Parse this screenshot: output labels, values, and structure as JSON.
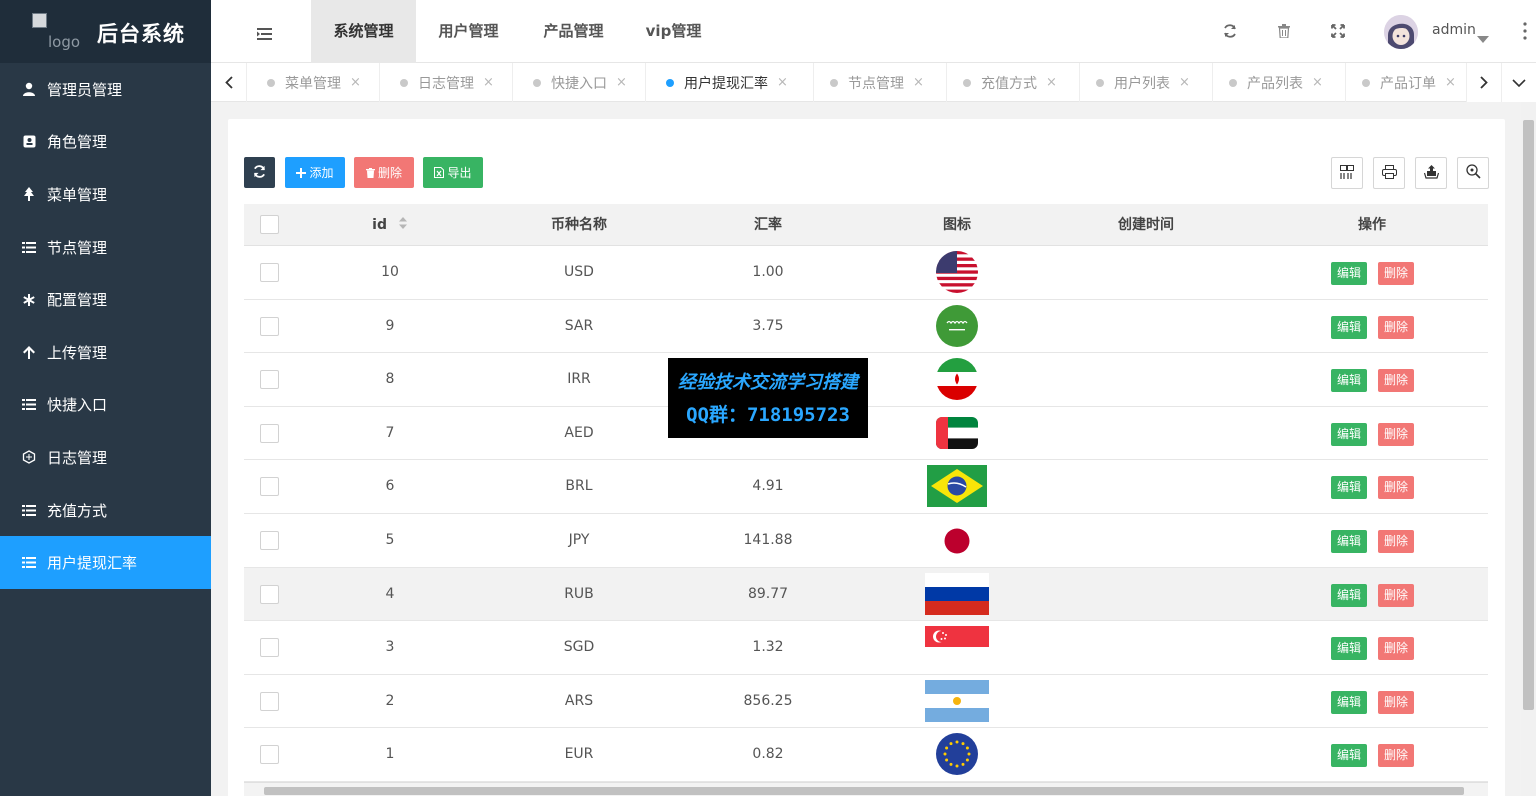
{
  "app": {
    "title": "后台系统",
    "logo_alt": "logo"
  },
  "sidebar": {
    "items": [
      {
        "label": "管理员管理",
        "icon": "user-icon",
        "active": false
      },
      {
        "label": "角色管理",
        "icon": "id-card-icon",
        "active": false
      },
      {
        "label": "菜单管理",
        "icon": "tree-icon",
        "active": false
      },
      {
        "label": "节点管理",
        "icon": "list-icon",
        "active": false
      },
      {
        "label": "配置管理",
        "icon": "asterisk-icon",
        "active": false
      },
      {
        "label": "上传管理",
        "icon": "arrow-up-icon",
        "active": false
      },
      {
        "label": "快捷入口",
        "icon": "list-icon",
        "active": false
      },
      {
        "label": "日志管理",
        "icon": "log-icon",
        "active": false
      },
      {
        "label": "充值方式",
        "icon": "list-icon",
        "active": false
      },
      {
        "label": "用户提现汇率",
        "icon": "list-icon",
        "active": true
      }
    ]
  },
  "header": {
    "tabs": [
      {
        "label": "系统管理",
        "active": true
      },
      {
        "label": "用户管理",
        "active": false
      },
      {
        "label": "产品管理",
        "active": false
      },
      {
        "label": "vip管理",
        "active": false
      }
    ],
    "icons": [
      "refresh-icon",
      "trash-icon",
      "fullscreen-icon"
    ],
    "user": {
      "name": "admin"
    }
  },
  "tabstrip": {
    "tabs": [
      {
        "label": "菜单管理",
        "active": false
      },
      {
        "label": "日志管理",
        "active": false
      },
      {
        "label": "快捷入口",
        "active": false
      },
      {
        "label": "用户提现汇率",
        "active": true
      },
      {
        "label": "节点管理",
        "active": false
      },
      {
        "label": "充值方式",
        "active": false
      },
      {
        "label": "用户列表",
        "active": false
      },
      {
        "label": "产品列表",
        "active": false
      },
      {
        "label": "产品订单",
        "active": false
      }
    ],
    "close_glyph": "×"
  },
  "toolbar": {
    "add_label": "添加",
    "delete_label": "删除",
    "export_label": "导出"
  },
  "table": {
    "columns": [
      "id",
      "币种名称",
      "汇率",
      "图标",
      "创建时间",
      "操作"
    ],
    "edit_label": "编辑",
    "delete_label": "删除",
    "rows": [
      {
        "id": "10",
        "currency": "USD",
        "rate": "1.00",
        "flag": "us-flag-icon",
        "created": ""
      },
      {
        "id": "9",
        "currency": "SAR",
        "rate": "3.75",
        "flag": "saudi-flag-icon",
        "created": ""
      },
      {
        "id": "8",
        "currency": "IRR",
        "rate": "",
        "flag": "iran-flag-icon",
        "created": ""
      },
      {
        "id": "7",
        "currency": "AED",
        "rate": "",
        "flag": "uae-flag-icon",
        "created": ""
      },
      {
        "id": "6",
        "currency": "BRL",
        "rate": "4.91",
        "flag": "brazil-flag-icon",
        "created": ""
      },
      {
        "id": "5",
        "currency": "JPY",
        "rate": "141.88",
        "flag": "japan-flag-icon",
        "created": ""
      },
      {
        "id": "4",
        "currency": "RUB",
        "rate": "89.77",
        "flag": "russia-flag-icon",
        "created": "",
        "highlighted": true
      },
      {
        "id": "3",
        "currency": "SGD",
        "rate": "1.32",
        "flag": "singapore-flag-icon",
        "created": ""
      },
      {
        "id": "2",
        "currency": "ARS",
        "rate": "856.25",
        "flag": "argentina-flag-icon",
        "created": ""
      },
      {
        "id": "1",
        "currency": "EUR",
        "rate": "0.82",
        "flag": "eu-flag-icon",
        "created": ""
      }
    ]
  },
  "watermark": {
    "line1": "经验技术交流学习搭建",
    "line2": "QQ群：718195723"
  },
  "colors": {
    "sidebar_bg": "#293846",
    "active_blue": "#1e9fff",
    "add_blue": "#1e9fff",
    "delete_red": "#f27775",
    "export_green": "#38b463"
  }
}
